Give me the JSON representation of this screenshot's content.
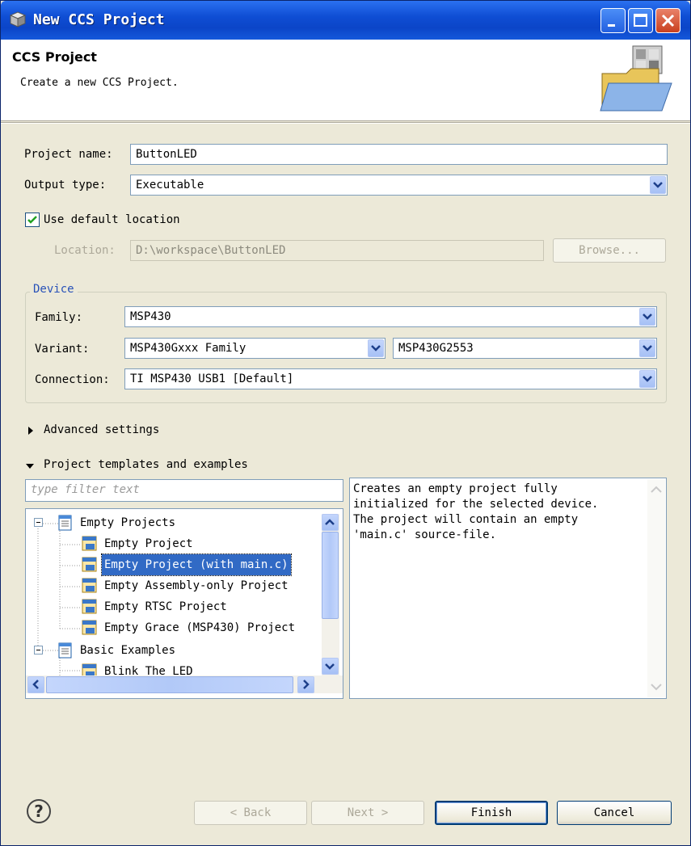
{
  "window": {
    "title": "New CCS Project"
  },
  "header": {
    "title": "CCS Project",
    "description": "Create a new CCS Project."
  },
  "form": {
    "project_name_label": "Project name:",
    "project_name_value": "ButtonLED",
    "output_type_label": "Output type:",
    "output_type_value": "Executable",
    "use_default_location_label": "Use default location",
    "use_default_location_checked": true,
    "location_label": "Location:",
    "location_value": "D:\\workspace\\ButtonLED",
    "browse_label": "Browse..."
  },
  "device": {
    "group_label": "Device",
    "family_label": "Family:",
    "family_value": "MSP430",
    "variant_label": "Variant:",
    "variant_filter_value": "MSP430Gxxx Family",
    "variant_value": "MSP430G2553",
    "connection_label": "Connection:",
    "connection_value": "TI MSP430 USB1 [Default]"
  },
  "sections": {
    "advanced": "Advanced settings",
    "templates": "Project templates and examples"
  },
  "templates": {
    "filter_placeholder": "type filter text",
    "tree": [
      {
        "label": "Empty Projects",
        "type": "folder",
        "expanded": true
      },
      {
        "label": "Empty Project",
        "type": "item"
      },
      {
        "label": "Empty Project (with main.c)",
        "type": "item",
        "selected": true
      },
      {
        "label": "Empty Assembly-only Project",
        "type": "item"
      },
      {
        "label": "Empty RTSC Project",
        "type": "item"
      },
      {
        "label": "Empty Grace (MSP430) Project",
        "type": "item"
      },
      {
        "label": "Basic Examples",
        "type": "folder",
        "expanded": true
      },
      {
        "label": "Blink The LED",
        "type": "item"
      }
    ],
    "description": "Creates an empty project fully\ninitialized for the selected device.\nThe project will contain an empty\n'main.c' source-file."
  },
  "buttons": {
    "back": "< Back",
    "next": "Next >",
    "finish": "Finish",
    "cancel": "Cancel"
  },
  "colors": {
    "title_bar": "#0b45c8",
    "selection": "#316ac5",
    "group_title": "#2952b8"
  }
}
